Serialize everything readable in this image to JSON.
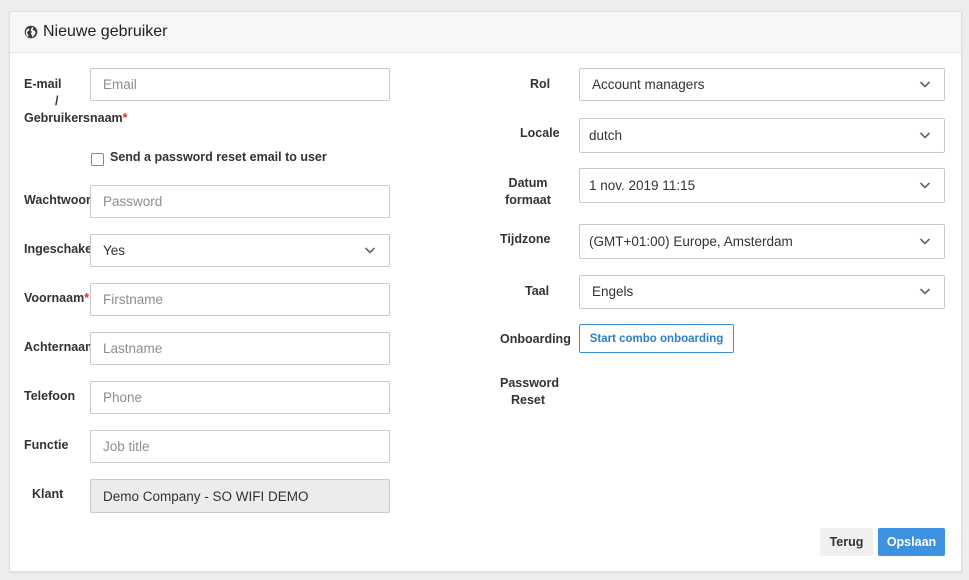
{
  "header": {
    "title": "Nieuwe gebruiker",
    "icon": "globe-icon"
  },
  "left": {
    "email_label_1": "E-mail",
    "email_label_2": "/",
    "email_label_3": "Gebruikersnaam",
    "email_placeholder": "Email",
    "reset_checkbox_label": "Send a password reset email to user",
    "reset_checkbox_checked": false,
    "password_label": "Wachtwoord",
    "password_placeholder": "Password",
    "enabled_label": "Ingeschakeld",
    "enabled_value": "Yes",
    "firstname_label": "Voornaam",
    "firstname_placeholder": "Firstname",
    "lastname_label": "Achternaam",
    "lastname_placeholder": "Lastname",
    "phone_label": "Telefoon",
    "phone_placeholder": "Phone",
    "jobtitle_label": "Functie",
    "jobtitle_placeholder": "Job title",
    "customer_label": "Klant",
    "customer_value": "Demo Company - SO WIFI DEMO"
  },
  "right": {
    "role_label": "Rol",
    "role_value": "Account managers",
    "locale_label": "Locale",
    "locale_value": "dutch",
    "dateformat_label_1": "Datum",
    "dateformat_label_2": "formaat",
    "dateformat_value": "1 nov. 2019 11:15",
    "timezone_label": "Tijdzone",
    "timezone_value": "(GMT+01:00) Europe, Amsterdam",
    "language_label": "Taal",
    "language_value": "Engels",
    "onboarding_label": "Onboarding",
    "onboarding_button": "Start combo onboarding",
    "pwreset_label_1": "Password",
    "pwreset_label_2": "Reset"
  },
  "footer": {
    "back_label": "Terug",
    "save_label": "Opslaan"
  },
  "required_marker": "*",
  "colors": {
    "primary": "#3c91e0",
    "required": "#d9302c"
  }
}
